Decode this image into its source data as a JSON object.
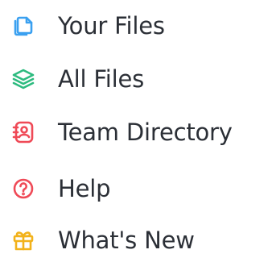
{
  "sidebar": {
    "items": [
      {
        "label": "Your Files",
        "icon": "file-copy-icon",
        "color": "#3aa0f0"
      },
      {
        "label": "All Files",
        "icon": "layers-icon",
        "color": "#2dbb7f"
      },
      {
        "label": "Team Directory",
        "icon": "contacts-book-icon",
        "color": "#ef4a57"
      },
      {
        "label": "Help",
        "icon": "help-circle-icon",
        "color": "#ef4a57"
      },
      {
        "label": "What's New",
        "icon": "gift-icon",
        "color": "#f2b21b"
      }
    ]
  }
}
